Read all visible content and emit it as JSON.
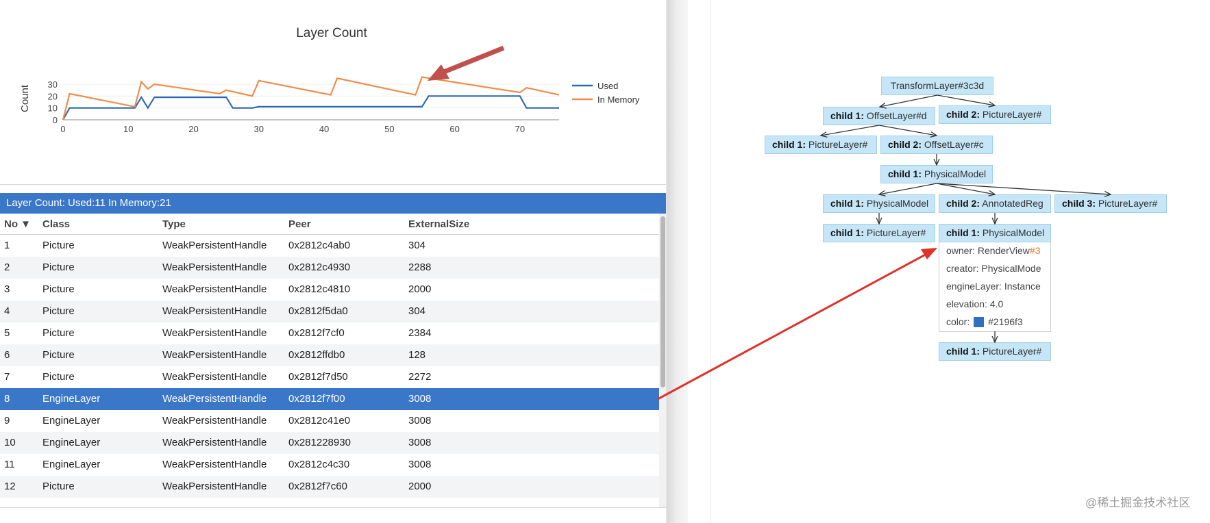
{
  "chart": {
    "chart_data": {
      "type": "line",
      "title": "Layer Count",
      "xlabel": "",
      "ylabel": "Count",
      "xlim": [
        0,
        76
      ],
      "ylim": [
        0,
        30
      ],
      "x_ticks": [
        "0",
        "10",
        "20",
        "30",
        "40",
        "50",
        "60",
        "70"
      ],
      "y_ticks": [
        "0",
        "10",
        "20",
        "30"
      ],
      "legend": "right",
      "grid": true,
      "series": [
        {
          "name": "Used",
          "color": "#2e6ab3",
          "points": [
            [
              0,
              0
            ],
            [
              1,
              10
            ],
            [
              11,
              10
            ],
            [
              12,
              19
            ],
            [
              13,
              10
            ],
            [
              14,
              19
            ],
            [
              25,
              19
            ],
            [
              26,
              10
            ],
            [
              29,
              10
            ],
            [
              30,
              11
            ],
            [
              55,
              11
            ],
            [
              56,
              20
            ],
            [
              70,
              20
            ],
            [
              71,
              10
            ],
            [
              76,
              10
            ]
          ]
        },
        {
          "name": "In Memory",
          "color": "#f08c4a",
          "points": [
            [
              0,
              0
            ],
            [
              1,
              22
            ],
            [
              11,
              11
            ],
            [
              12,
              32
            ],
            [
              13,
              26
            ],
            [
              14,
              30
            ],
            [
              24,
              22
            ],
            [
              25,
              25
            ],
            [
              29,
              20
            ],
            [
              30,
              33
            ],
            [
              41,
              21
            ],
            [
              42,
              35
            ],
            [
              54,
              21
            ],
            [
              55,
              36
            ],
            [
              70,
              23
            ],
            [
              71,
              27
            ],
            [
              76,
              21
            ]
          ]
        }
      ]
    }
  },
  "table": {
    "summary": "Layer Count: Used:11 In Memory:21",
    "headers": [
      "No ▼",
      "Class",
      "Type",
      "Peer",
      "ExternalSize"
    ],
    "rows": [
      [
        "1",
        "Picture",
        "WeakPersistentHandle",
        "0x2812c4ab0",
        "304"
      ],
      [
        "2",
        "Picture",
        "WeakPersistentHandle",
        "0x2812c4930",
        "2288"
      ],
      [
        "3",
        "Picture",
        "WeakPersistentHandle",
        "0x2812c4810",
        "2000"
      ],
      [
        "4",
        "Picture",
        "WeakPersistentHandle",
        "0x2812f5da0",
        "304"
      ],
      [
        "5",
        "Picture",
        "WeakPersistentHandle",
        "0x2812f7cf0",
        "2384"
      ],
      [
        "6",
        "Picture",
        "WeakPersistentHandle",
        "0x2812ffdb0",
        "128"
      ],
      [
        "7",
        "Picture",
        "WeakPersistentHandle",
        "0x2812f7d50",
        "2272"
      ],
      [
        "8",
        "EngineLayer",
        "WeakPersistentHandle",
        "0x2812f7f00",
        "3008"
      ],
      [
        "9",
        "EngineLayer",
        "WeakPersistentHandle",
        "0x2812c41e0",
        "3008"
      ],
      [
        "10",
        "EngineLayer",
        "WeakPersistentHandle",
        "0x281228930",
        "3008"
      ],
      [
        "11",
        "EngineLayer",
        "WeakPersistentHandle",
        "0x2812c4c30",
        "3008"
      ],
      [
        "12",
        "Picture",
        "WeakPersistentHandle",
        "0x2812f7c60",
        "2000"
      ]
    ],
    "selected_row": 8
  },
  "tree": {
    "root": "TransformLayer#3c3d",
    "child_prefix_1": "child 1:",
    "child_prefix_2": "child 2:",
    "child_prefix_3": "child 3:",
    "n_offset_d": "OffsetLayer#d",
    "n_picture_a": "PictureLayer#",
    "n_picture_b": "PictureLayer#",
    "n_offset_c": "OffsetLayer#c",
    "n_physical_1": "PhysicalModel",
    "n_physical_2": "PhysicalModel",
    "n_annotated": "AnnotatedReg",
    "n_picture_c": "PictureLayer#",
    "n_picture_d": "PictureLayer#",
    "n_physical_3": "PhysicalModel",
    "n_picture_e": "PictureLayer#",
    "props": {
      "owner_label": "owner: RenderView",
      "owner_hash": "#3",
      "creator": "creator: PhysicalMode",
      "engine_layer": "engineLayer: Instance",
      "elevation": "elevation: 4.0",
      "color_label": "color:",
      "color_value": "#2196f3",
      "swatch_color": "#2f6fc4"
    }
  },
  "watermark": "@稀土掘金技术社区",
  "colors": {
    "accent": "#3b77c9",
    "annotation_arrow_dark": "#c0504d",
    "annotation_arrow_red": "#e0312a"
  }
}
